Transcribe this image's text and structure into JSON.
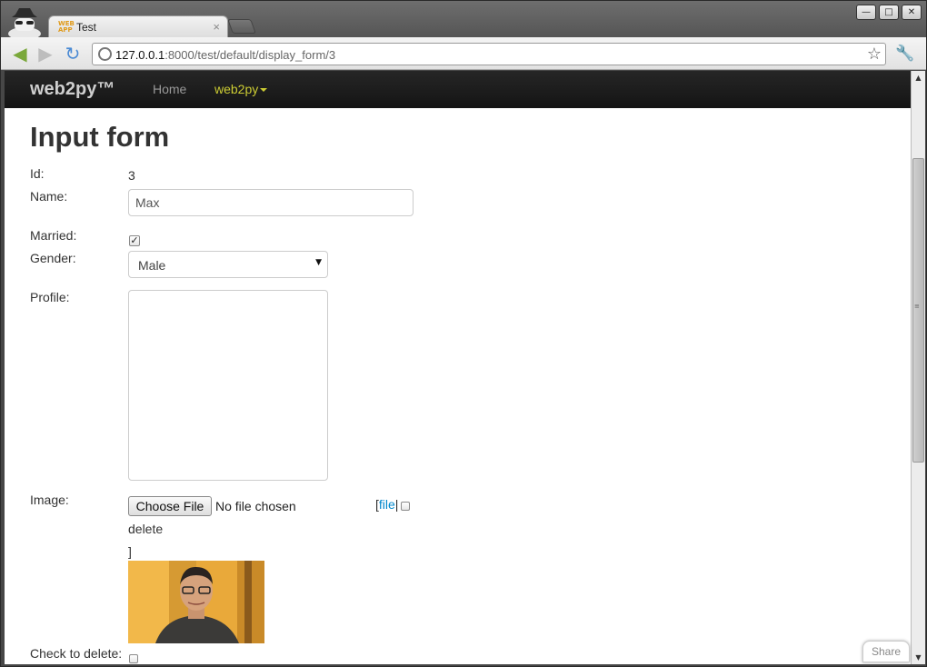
{
  "browser": {
    "tab_title": "Test",
    "tab_favicon": "web2py-app-icon",
    "tab_close": "×",
    "url_host": "127.0.0.1",
    "url_rest": ":8000/test/default/display_form/3",
    "window_buttons": {
      "minimize": "—",
      "maximize": "□",
      "close": "✕"
    }
  },
  "navbar": {
    "brand": "web2py™",
    "home_label": "Home",
    "web2py_label": "web2py"
  },
  "form": {
    "title": "Input form",
    "id_label": "Id:",
    "id_value": "3",
    "name_label": "Name:",
    "name_value": "Max",
    "married_label": "Married:",
    "married_checked": true,
    "gender_label": "Gender:",
    "gender_value": "Male",
    "profile_label": "Profile:",
    "profile_value": "",
    "image_label": "Image:",
    "choose_file_label": "Choose File",
    "no_file_label": "No file chosen",
    "file_open_bracket": "[",
    "file_link": "file",
    "file_sep": "|",
    "delete_label": "delete",
    "close_bracket": "]",
    "check_delete_label": "Check to delete:"
  },
  "share_label": "Share",
  "colors": {
    "navbar_bg": "#1b1b1b",
    "nav_active": "#cccc33",
    "link": "#0088cc"
  }
}
